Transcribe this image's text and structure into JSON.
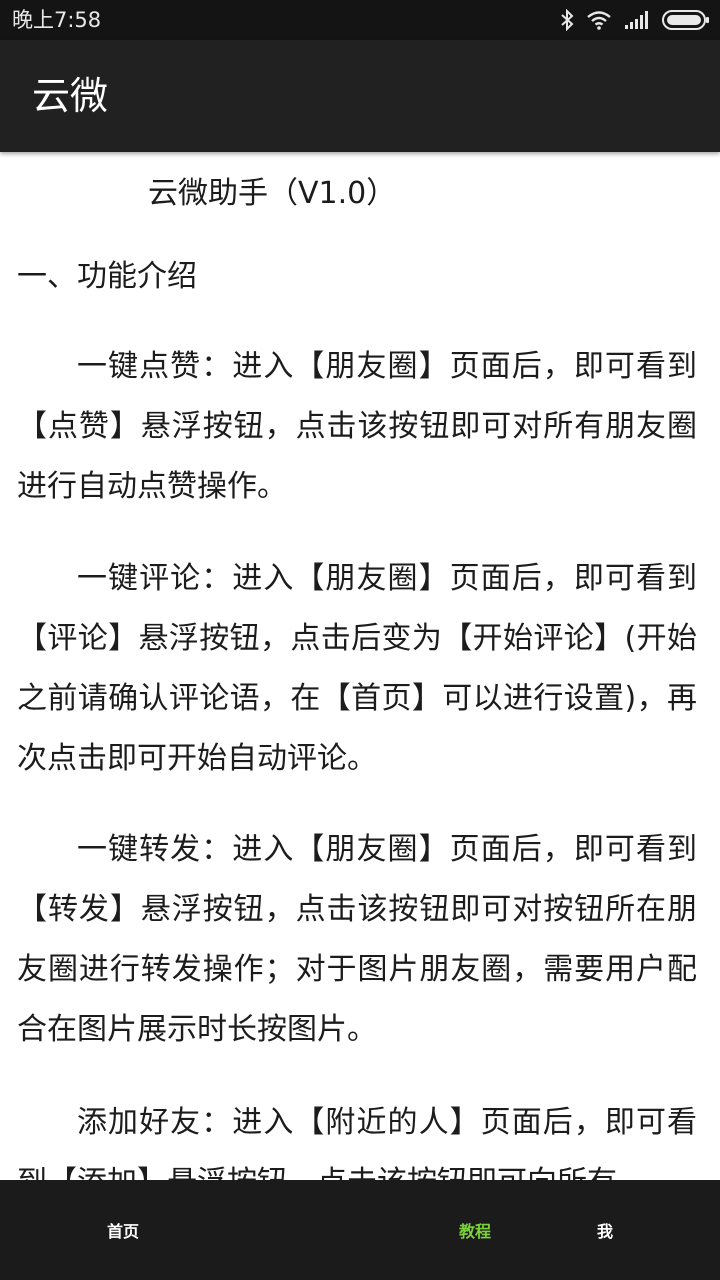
{
  "status_bar": {
    "time": "晚上7:58",
    "icons": [
      "bluetooth-icon",
      "wifi-icon",
      "signal-icon",
      "battery-icon"
    ]
  },
  "app_bar": {
    "title": "云微"
  },
  "content": {
    "doc_title": "云微助手（V1.0）",
    "section_heading": "一、功能介绍",
    "paragraphs": [
      "一键点赞：进入【朋友圈】页面后，即可看到【点赞】悬浮按钮，点击该按钮即可对所有朋友圈进行自动点赞操作。",
      "一键评论：进入【朋友圈】页面后，即可看到【评论】悬浮按钮，点击后变为【开始评论】(开始之前请确认评论语，在【首页】可以进行设置)，再次点击即可开始自动评论。",
      "一键转发：进入【朋友圈】页面后，即可看到【转发】悬浮按钮，点击该按钮即可对按钮所在朋友圈进行转发操作；对于图片朋友圈，需要用户配合在图片展示时长按图片。",
      "添加好友：进入【附近的人】页面后，即可看到【添加】悬浮按钮，点击该按钮即可向所有"
    ]
  },
  "bottom_nav": {
    "items": [
      {
        "label": "首页",
        "active": false
      },
      {
        "label": "教程",
        "active": true
      },
      {
        "label": "我",
        "active": false
      }
    ],
    "active_color": "#7ad13a"
  }
}
